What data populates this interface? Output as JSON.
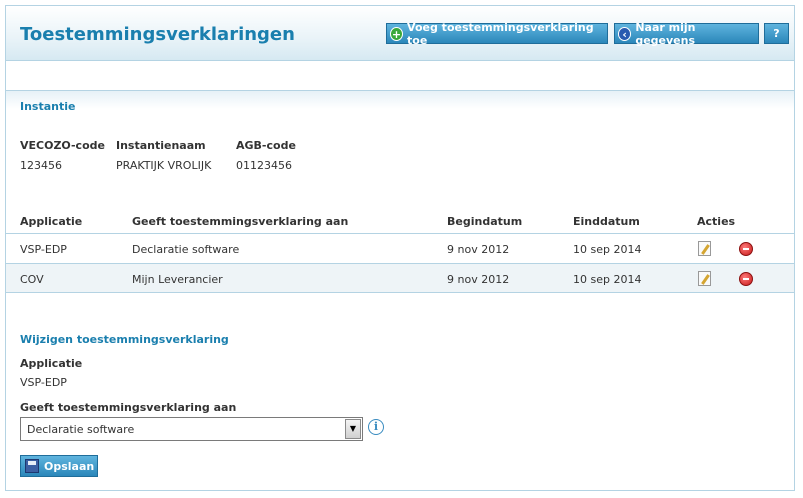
{
  "header": {
    "title": "Toestemmingsverklaringen",
    "add_button": "Voeg toestemmingsverklaring toe",
    "back_button": "Naar mijn gegevens",
    "help_button": "?"
  },
  "instantie": {
    "section_title": "Instantie",
    "columns": [
      "VECOZO-code",
      "Instantienaam",
      "AGB-code"
    ],
    "values": [
      "123456",
      "PRAKTIJK VROLIJK",
      "01123456"
    ]
  },
  "table": {
    "headers": [
      "Applicatie",
      "Geeft toestemmingsverklaring aan",
      "Begindatum",
      "Einddatum",
      "Acties"
    ],
    "rows": [
      {
        "applicatie": "VSP-EDP",
        "aan": "Declaratie software",
        "begin": "9 nov 2012",
        "eind": "10 sep 2014"
      },
      {
        "applicatie": "COV",
        "aan": "Mijn Leverancier",
        "begin": "9 nov 2012",
        "eind": "10 sep 2014"
      }
    ]
  },
  "edit": {
    "section_title": "Wijzigen toestemmingsverklaring",
    "applicatie_label": "Applicatie",
    "applicatie_value": "VSP-EDP",
    "aan_label": "Geeft toestemmingsverklaring aan",
    "select_value": "Declaratie software",
    "save_button": "Opslaan"
  },
  "icons": {
    "add": "plus-circle-icon",
    "back": "arrow-left-circle-icon",
    "edit": "edit-pencil-icon",
    "delete": "delete-minus-icon",
    "info": "info-icon",
    "save": "floppy-disk-icon"
  },
  "colors": {
    "accent": "#1a7fae",
    "button": "#2b87ba",
    "border": "#b4d3e3"
  }
}
